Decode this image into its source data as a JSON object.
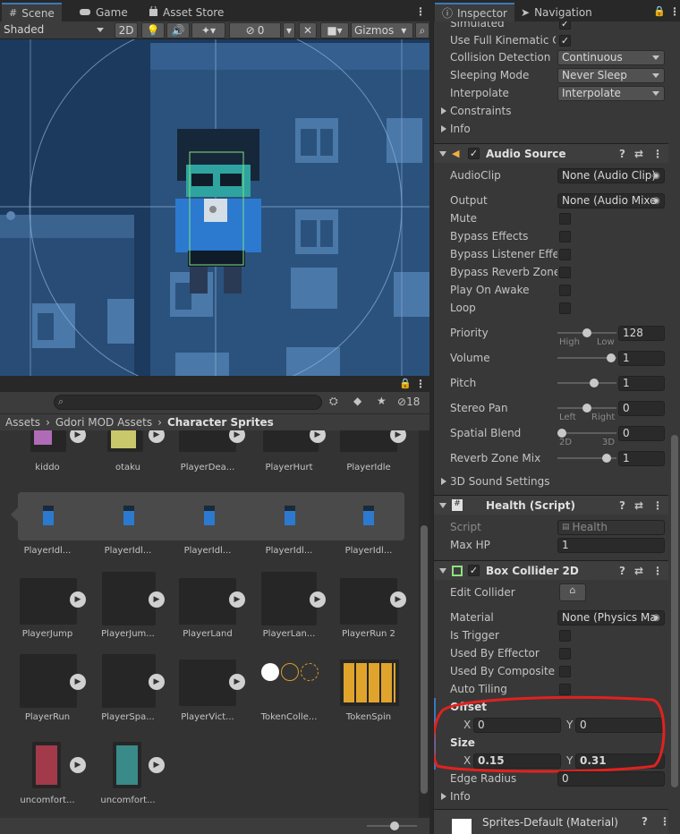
{
  "scene_tabs": {
    "scene": "Scene",
    "game": "Game",
    "asset_store": "Asset Store"
  },
  "scene_toolbar": {
    "shading": "Shaded",
    "mode_2d": "2D",
    "hidden_count": "0",
    "gizmos": "Gizmos"
  },
  "inspector_tabs": {
    "inspector": "Inspector",
    "navigation": "Navigation"
  },
  "project": {
    "search_placeholder": "",
    "hidden_count": "18",
    "breadcrumb": [
      "Assets",
      "Gdori MOD Assets",
      "Character Sprites"
    ],
    "row1": [
      "kiddo",
      "otaku",
      "PlayerDea...",
      "PlayerHurt",
      "PlayerIdle"
    ],
    "row2": [
      "PlayerIdl...",
      "PlayerIdl...",
      "PlayerIdl...",
      "PlayerIdl...",
      "PlayerIdl..."
    ],
    "row3": [
      "PlayerJump",
      "PlayerJum...",
      "PlayerLand",
      "PlayerLan...",
      "PlayerRun 2"
    ],
    "row4": [
      "PlayerRun",
      "PlayerSpa...",
      "PlayerVict...",
      "TokenColle...",
      "TokenSpin"
    ],
    "row5": [
      "uncomfort...",
      "uncomfort..."
    ]
  },
  "rigidbody": {
    "simulated_label": "Simulated",
    "kinematic_label": "Use Full Kinematic Co",
    "collision_label": "Collision Detection",
    "collision_value": "Continuous",
    "sleeping_label": "Sleeping Mode",
    "sleeping_value": "Never Sleep",
    "interpolate_label": "Interpolate",
    "interpolate_value": "Interpolate",
    "constraints": "Constraints",
    "info": "Info"
  },
  "audio": {
    "title": "Audio Source",
    "clip_label": "AudioClip",
    "clip_value": "None (Audio Clip)",
    "output_label": "Output",
    "output_value": "None (Audio Mixe",
    "mute": "Mute",
    "bypass_effects": "Bypass Effects",
    "bypass_listener": "Bypass Listener Effec",
    "bypass_reverb": "Bypass Reverb Zones",
    "play_on_awake": "Play On Awake",
    "loop": "Loop",
    "priority_label": "Priority",
    "priority_value": "128",
    "priority_high": "High",
    "priority_low": "Low",
    "volume_label": "Volume",
    "volume_value": "1",
    "pitch_label": "Pitch",
    "pitch_value": "1",
    "stereo_label": "Stereo Pan",
    "stereo_value": "0",
    "stereo_left": "Left",
    "stereo_right": "Right",
    "spatial_label": "Spatial Blend",
    "spatial_value": "0",
    "spatial_2d": "2D",
    "spatial_3d": "3D",
    "reverb_label": "Reverb Zone Mix",
    "reverb_value": "1",
    "settings_3d": "3D Sound Settings"
  },
  "health": {
    "title": "Health (Script)",
    "script_label": "Script",
    "script_value": "Health",
    "maxhp_label": "Max HP",
    "maxhp_value": "1"
  },
  "box": {
    "title": "Box Collider 2D",
    "edit_label": "Edit Collider",
    "material_label": "Material",
    "material_value": "None (Physics Ma",
    "is_trigger": "Is Trigger",
    "used_effector": "Used By Effector",
    "used_composite": "Used By Composite",
    "auto_tiling": "Auto Tiling",
    "offset_label": "Offset",
    "offset_x": "0",
    "offset_y": "0",
    "size_label": "Size",
    "size_x": "0.15",
    "size_y": "0.31",
    "edge_label": "Edge Radius",
    "edge_value": "0",
    "info": "Info",
    "x": "X",
    "y": "Y"
  },
  "material": {
    "name": "Sprites-Default (Material)"
  },
  "colors": {
    "accent": "#3a79bb",
    "highlight": "#e0221f"
  }
}
